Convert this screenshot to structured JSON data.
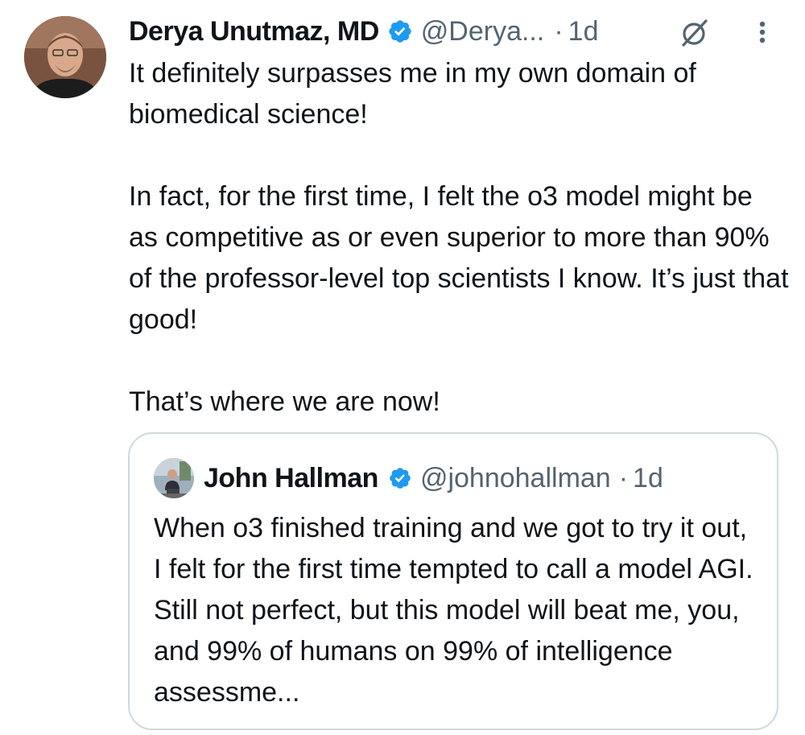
{
  "tweet": {
    "author_name": "Derya Unutmaz, MD",
    "author_handle": "@Derya...",
    "separator": "·",
    "time": "1d",
    "paragraphs": [
      "It definitely surpasses me in my own domain of biomedical science!",
      "In fact, for the first time, I felt the o3 model might be as competitive as or even superior to more than 90% of the professor-level top scientists I know. It’s just that good!",
      "That’s where we are now!"
    ]
  },
  "quoted_tweet": {
    "author_name": "John Hallman",
    "author_handle": "@johnohallman",
    "separator": "·",
    "time": "1d",
    "text": "When o3 finished training and we got to try it out, I felt for the first time tempted to call a model AGI. Still not perfect, but this model will beat me, you, and 99% of humans on 99% of intelligence assessme..."
  },
  "icons": {
    "verified": "verified-badge-icon",
    "grok": "grok-icon",
    "more": "more-options-icon"
  },
  "colors": {
    "verified": "#1d9bf0",
    "text_primary": "#0f1419",
    "text_secondary": "#536471",
    "border": "#cfd9de"
  }
}
